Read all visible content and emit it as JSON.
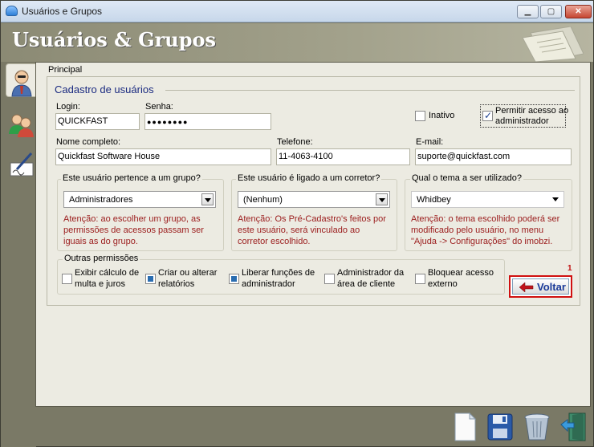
{
  "window": {
    "title": "Usuários e Grupos",
    "controls": {
      "minimize": "▁",
      "maximize": "▢",
      "close": "✕"
    }
  },
  "header": {
    "title": "Usuários & Grupos"
  },
  "sidebar": {
    "items": [
      {
        "icon": "user-icon",
        "active": true
      },
      {
        "icon": "group-icon",
        "active": false
      },
      {
        "icon": "signature-icon",
        "active": false
      }
    ]
  },
  "tab": {
    "label": "Principal"
  },
  "form": {
    "section_title": "Cadastro de usuários",
    "login": {
      "label": "Login:",
      "value": "QUICKFAST"
    },
    "senha": {
      "label": "Senha:",
      "value": "●●●●●●●●"
    },
    "inativo": {
      "label": "Inativo",
      "checked": false
    },
    "permitir": {
      "label_line1": "Permitir acesso ao",
      "label_line2": "administrador",
      "checked": true
    },
    "nome": {
      "label": "Nome completo:",
      "value": "Quickfast Software House"
    },
    "telefone": {
      "label": "Telefone:",
      "value": "11-4063-4100"
    },
    "email": {
      "label": "E-mail:",
      "value": "suporte@quickfast.com"
    }
  },
  "groups": {
    "grupo": {
      "title": "Este usuário pertence a um grupo?",
      "selected": "Administradores",
      "warning": [
        "Atenção: ao escolher um grupo, as",
        "permissões de acessos passam ser",
        "iguais as do grupo."
      ]
    },
    "corretor": {
      "title": "Este usuário é ligado a um corretor?",
      "selected": "(Nenhum)",
      "warning": [
        "Atenção: Os Pré-Cadastro's feitos por",
        "este usuário, será vinculado ao",
        "corretor escolhido."
      ]
    },
    "tema": {
      "title": "Qual o tema a ser utilizado?",
      "selected": "Whidbey",
      "warning": [
        "Atenção: o tema escolhido poderá ser",
        "modificado pelo usuário, no menu",
        "\"Ajuda -> Configurações\" do imobzi."
      ]
    }
  },
  "outras": {
    "title": "Outras permissões",
    "items": [
      {
        "line1": "Exibir cálculo de",
        "line2": "multa e juros",
        "checked": false
      },
      {
        "line1": "Criar ou alterar",
        "line2": "relatórios",
        "checked": true
      },
      {
        "line1": "Liberar funções de",
        "line2": "administrador",
        "checked": true
      },
      {
        "line1": "Administrador da",
        "line2": "área de cliente",
        "checked": false
      },
      {
        "line1": "Bloquear acesso",
        "line2": "externo",
        "checked": false
      }
    ]
  },
  "voltar": {
    "label": "Voltar",
    "badge": "1"
  },
  "footer": {
    "icons": [
      "new-document-icon",
      "save-icon",
      "trash-icon",
      "exit-door-icon"
    ]
  }
}
